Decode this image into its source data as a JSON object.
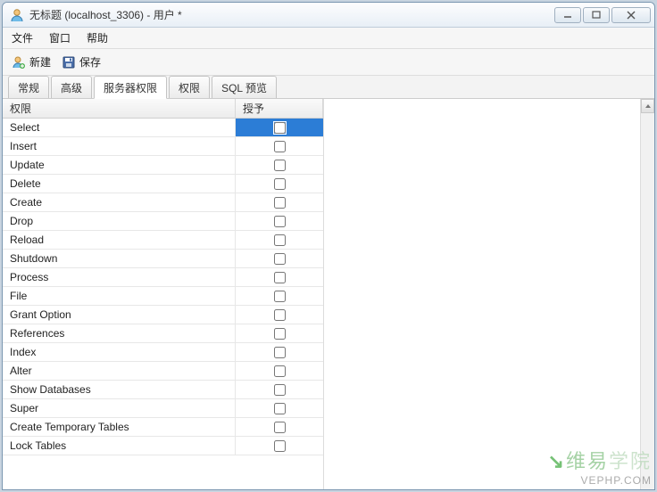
{
  "window": {
    "title": "无标题 (localhost_3306) - 用户 *"
  },
  "menubar": {
    "file": "文件",
    "window": "窗口",
    "help": "帮助"
  },
  "toolbar": {
    "new_label": "新建",
    "save_label": "保存"
  },
  "tabs": {
    "general": "常规",
    "advanced": "高级",
    "server_priv": "服务器权限",
    "privileges": "权限",
    "sql_preview": "SQL 预览"
  },
  "grid": {
    "header_priv": "权限",
    "header_grant": "授予",
    "rows": [
      {
        "name": "Select",
        "granted": false,
        "selected": true
      },
      {
        "name": "Insert",
        "granted": false,
        "selected": false
      },
      {
        "name": "Update",
        "granted": false,
        "selected": false
      },
      {
        "name": "Delete",
        "granted": false,
        "selected": false
      },
      {
        "name": "Create",
        "granted": false,
        "selected": false
      },
      {
        "name": "Drop",
        "granted": false,
        "selected": false
      },
      {
        "name": "Reload",
        "granted": false,
        "selected": false
      },
      {
        "name": "Shutdown",
        "granted": false,
        "selected": false
      },
      {
        "name": "Process",
        "granted": false,
        "selected": false
      },
      {
        "name": "File",
        "granted": false,
        "selected": false
      },
      {
        "name": "Grant Option",
        "granted": false,
        "selected": false
      },
      {
        "name": "References",
        "granted": false,
        "selected": false
      },
      {
        "name": "Index",
        "granted": false,
        "selected": false
      },
      {
        "name": "Alter",
        "granted": false,
        "selected": false
      },
      {
        "name": "Show Databases",
        "granted": false,
        "selected": false
      },
      {
        "name": "Super",
        "granted": false,
        "selected": false
      },
      {
        "name": "Create Temporary Tables",
        "granted": false,
        "selected": false
      },
      {
        "name": "Lock Tables",
        "granted": false,
        "selected": false
      }
    ]
  },
  "watermark": {
    "line1_a": "维易",
    "line1_b": "学院",
    "line2": "VEPHP.COM",
    "leaf": "↘"
  }
}
